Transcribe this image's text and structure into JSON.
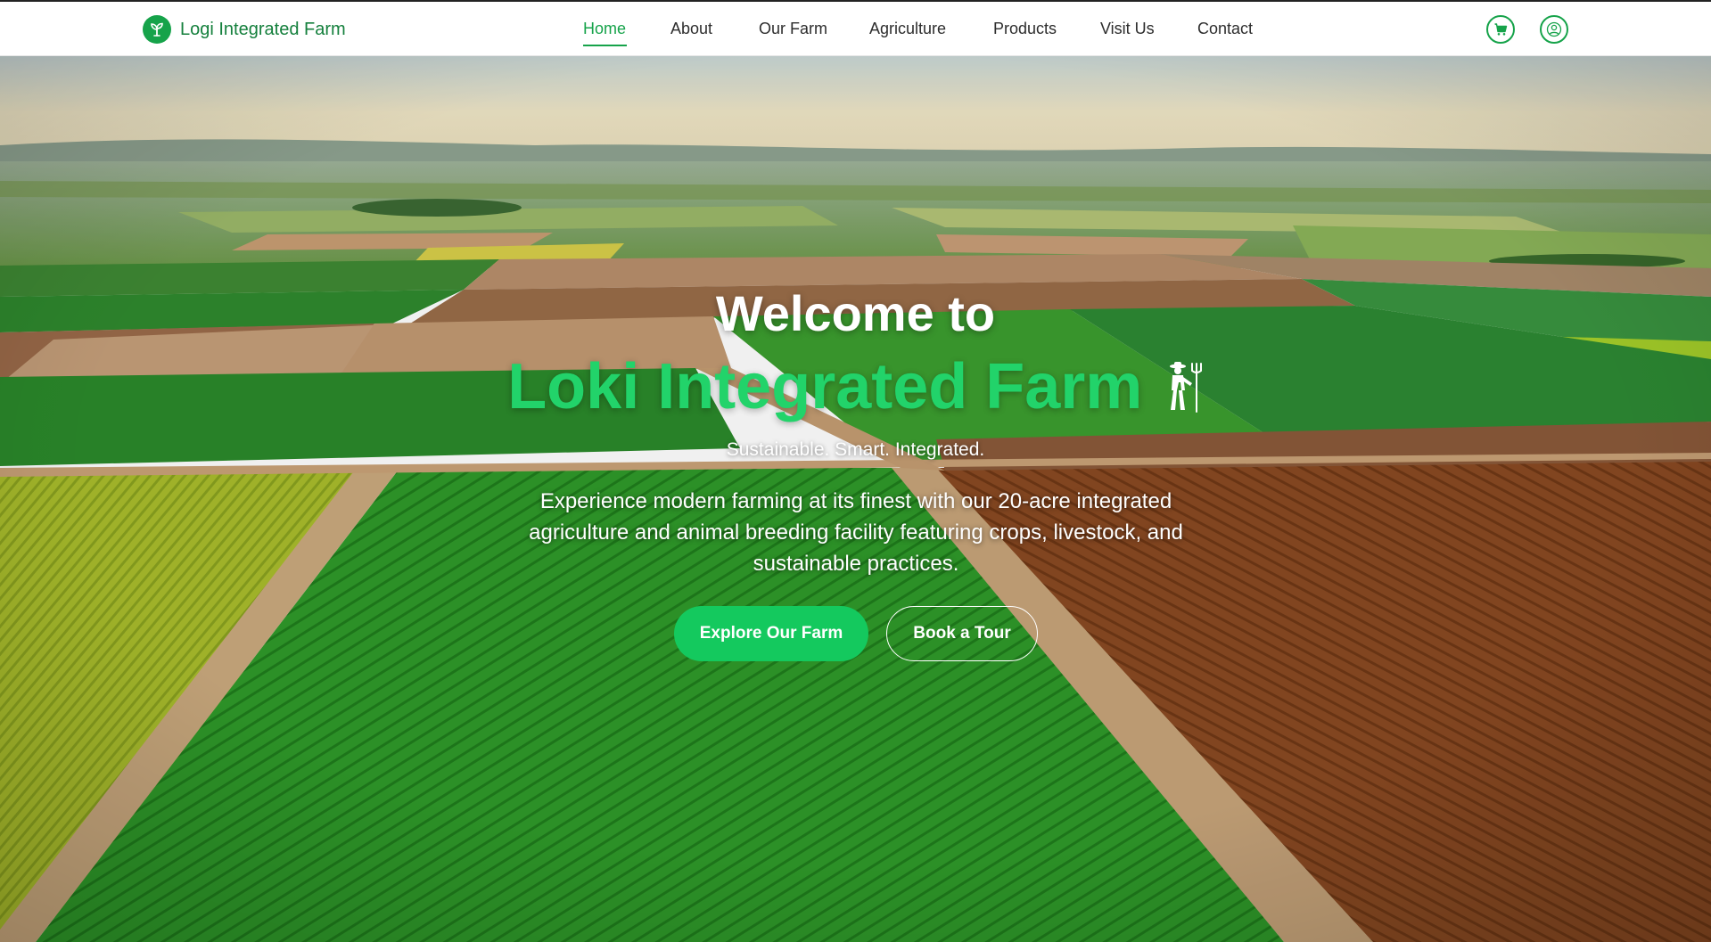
{
  "brand": {
    "name": "Logi Integrated Farm",
    "icon": "sprout-icon"
  },
  "nav": {
    "items": [
      {
        "label": "Home",
        "active": true
      },
      {
        "label": "About"
      },
      {
        "label": "Our Farm"
      },
      {
        "label": "Agriculture"
      },
      {
        "label": "Products"
      },
      {
        "label": "Visit Us"
      },
      {
        "label": "Contact"
      }
    ],
    "cart_icon": "cart-icon",
    "account_icon": "user-icon"
  },
  "hero": {
    "welcome": "Welcome to",
    "title": "Loki Integrated Farm",
    "title_icon": "farmer-with-pitchfork-icon",
    "tagline": "Sustainable. Smart. Integrated.",
    "description": "Experience modern farming at its finest with our 20-acre integrated agriculture and animal breeding facility featuring crops, livestock, and sustainable practices.",
    "primary_button": "Explore Our Farm",
    "secondary_button": "Book a Tour"
  },
  "colors": {
    "accent": "#16a34a",
    "title_green": "#22d36a",
    "button_green": "#14c95e"
  }
}
